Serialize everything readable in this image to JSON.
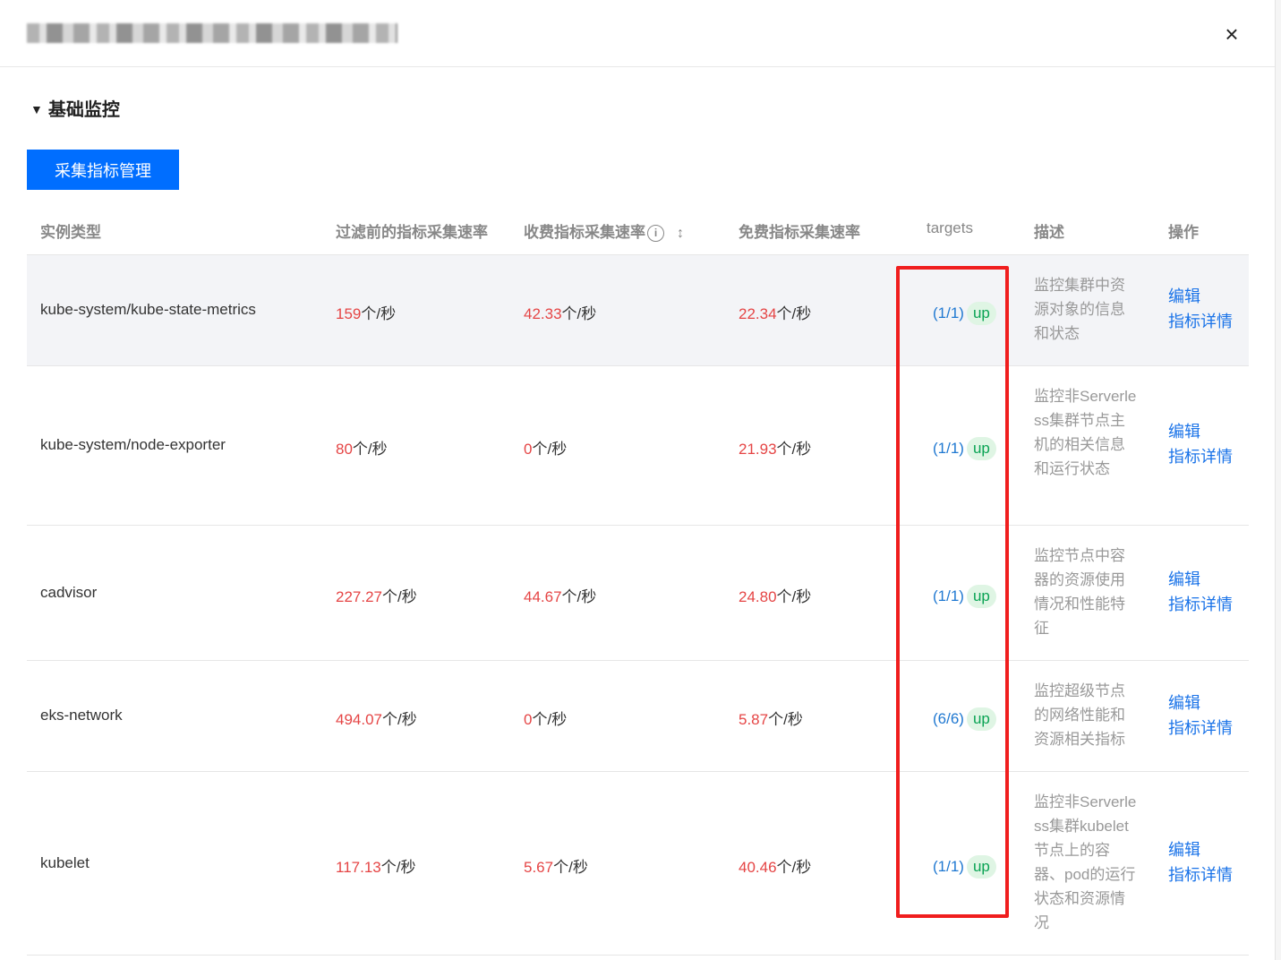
{
  "header": {
    "close_label": "×"
  },
  "section": {
    "toggle_icon": "caret-down",
    "title": "基础监控"
  },
  "toolbar": {
    "manage_button": "采集指标管理"
  },
  "table": {
    "columns": [
      "实例类型",
      "过滤前的指标采集速率",
      "收费指标采集速率",
      "免费指标采集速率",
      "targets",
      "描述",
      "操作"
    ],
    "info_icon": "i",
    "sort_icon": "↕",
    "unit": "个/秒",
    "rows": [
      {
        "instance": "kube-system/kube-state-metrics",
        "before": "159",
        "paid": "42.33",
        "free": "22.34",
        "targets_fraction": "(1/1)",
        "targets_status": "up",
        "desc": "监控集群中资源对象的信息和状态",
        "edit": "编辑",
        "detail": "指标详情"
      },
      {
        "instance": "kube-system/node-exporter",
        "before": "80",
        "paid": "0",
        "free": "21.93",
        "targets_fraction": "(1/1)",
        "targets_status": "up",
        "desc": "监控非Serverless集群节点主机的相关信息和运行状态",
        "edit": "编辑",
        "detail": "指标详情"
      },
      {
        "instance": "cadvisor",
        "before": "227.27",
        "paid": "44.67",
        "free": "24.80",
        "targets_fraction": "(1/1)",
        "targets_status": "up",
        "desc": "监控节点中容器的资源使用情况和性能特征",
        "edit": "编辑",
        "detail": "指标详情"
      },
      {
        "instance": "eks-network",
        "before": "494.07",
        "paid": "0",
        "free": "5.87",
        "targets_fraction": "(6/6)",
        "targets_status": "up",
        "desc": "监控超级节点的网络性能和资源相关指标",
        "edit": "编辑",
        "detail": "指标详情"
      },
      {
        "instance": "kubelet",
        "before": "117.13",
        "paid": "5.67",
        "free": "40.46",
        "targets_fraction": "(1/1)",
        "targets_status": "up",
        "desc": "监控非Serverless集群kubelet节点上的容器、pod的运行状态和资源情况",
        "edit": "编辑",
        "detail": "指标详情"
      }
    ]
  },
  "colors": {
    "primary": "#006eff",
    "value_red": "#e54545",
    "link_blue": "#1a73e8",
    "up_green": "#0aa354",
    "highlight_box": "#f01e1e"
  }
}
